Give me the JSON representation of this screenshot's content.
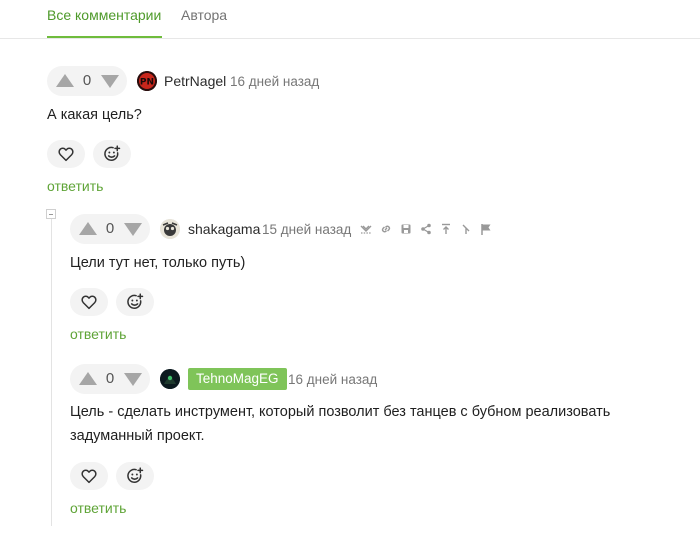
{
  "tabs": {
    "all": "Все комментарии",
    "authors": "Автора"
  },
  "comments": [
    {
      "score": "0",
      "author": "PetrNagel",
      "time": "16 дней назад",
      "text": "А какая цель?",
      "reply": "ответить",
      "avatar_initials": "PN"
    },
    {
      "score": "0",
      "author": "shakagama",
      "time": "15 дней назад",
      "text": "Цели тут нет, только путь)",
      "reply": "ответить",
      "tool_icons": [
        "hide-icon",
        "link-icon",
        "save-icon",
        "share-icon",
        "parent-icon",
        "branch-icon",
        "flag-icon"
      ]
    },
    {
      "score": "0",
      "author": "TehnoMagEG",
      "time": "16 дней назад",
      "text_line1": "Цель - сделать инструмент, который позволит без танцев с бубном реализовать",
      "text_line2": "задуманный проект.",
      "reply": "ответить"
    }
  ],
  "colors": {
    "accent": "#5fa437",
    "badge": "#7fc459",
    "vote_bg": "#f3f3f3"
  }
}
